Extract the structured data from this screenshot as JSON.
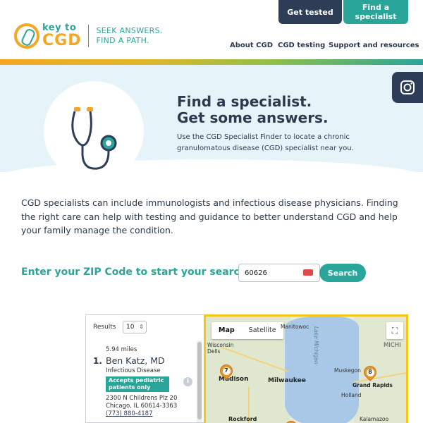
{
  "header": {
    "logo_key": "key to",
    "logo_cgd": "CGD",
    "tagline_line1": "SEEK ANSWERS.",
    "tagline_line2": "FIND A PATH.",
    "btn_get_tested": "Get tested",
    "btn_find_specialist": "Find a specialist",
    "nav": [
      "About CGD",
      "CGD testing",
      "Support and resources"
    ]
  },
  "hero": {
    "title_line1": "Find a specialist.",
    "title_line2": "Get some answers.",
    "subtitle": "Use the CGD Specialist Finder to locate a chronic granulomatous disease (CGD) specialist near you.",
    "illustration_icon": "stethoscope-icon"
  },
  "social": {
    "icon": "instagram-icon"
  },
  "intro": "CGD specialists can include immunologists and infectious disease physicians. Finding the right care can help with testing and guidance to better understand CGD and help your family manage the condition.",
  "search": {
    "label": "Enter your ZIP Code to start your search:",
    "zip_value": "60626",
    "button": "Search"
  },
  "results": {
    "label": "Results",
    "count": "10",
    "items": [
      {
        "distance": "5.94 miles",
        "number": "1.",
        "name": "Ben Katz, MD",
        "specialty": "Infectious Disease",
        "badge_line1": "Accepts pediatric",
        "badge_line2": "patients only",
        "address1": "2300 N Childrens Plz 20",
        "address2": "Chicago, IL 60614-3363",
        "phone": "(773) 880-4187"
      }
    ]
  },
  "map": {
    "tab_map": "Map",
    "tab_satellite": "Satellite",
    "labels": [
      "Manitowoc",
      "Lake Michigan",
      "MICHI",
      "Wisconsin Dells",
      "Madison",
      "Milwaukee",
      "Muskegon",
      "Grand Rapids",
      "Holland",
      "Rockford",
      "Kalamazoo"
    ],
    "pins": [
      "7",
      "8"
    ],
    "pin_color": "#e8952b"
  },
  "colors": {
    "teal": "#2aa59a",
    "navy": "#2d3c57",
    "orange": "#f5a623",
    "hero_bg": "#e6f4fa"
  }
}
